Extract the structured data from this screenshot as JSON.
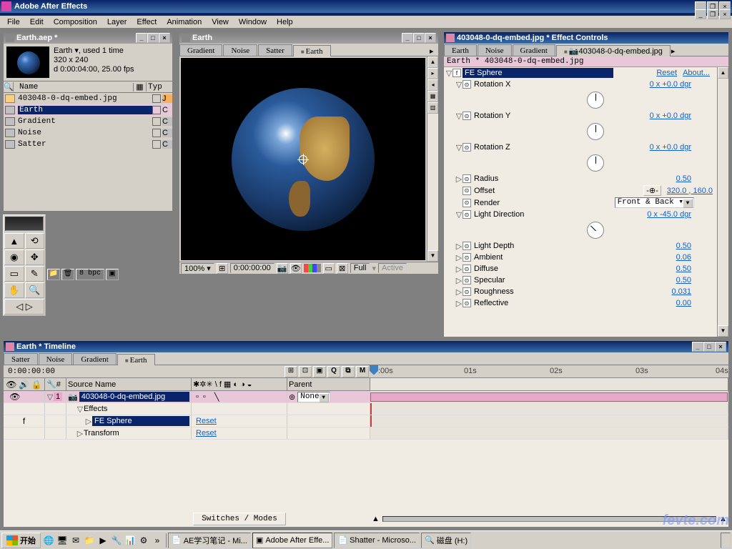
{
  "app": {
    "title": "Adobe After Effects"
  },
  "menu": [
    "File",
    "Edit",
    "Composition",
    "Layer",
    "Effect",
    "Animation",
    "View",
    "Window",
    "Help"
  ],
  "project": {
    "title": "Earth.aep *",
    "info_name": "Earth ▾, used 1 time",
    "info_dims": "320 x 240",
    "info_dur": "d 0:00:04:00, 25.00 fps",
    "col_name": "Name",
    "col_type": "Typ",
    "items": [
      {
        "name": "403048-0-dq-embed.jpg",
        "type": "img",
        "color": "#f8b060"
      },
      {
        "name": "Earth",
        "type": "comp",
        "color": "#e8c8d8",
        "sel": true
      },
      {
        "name": "Gradient",
        "type": "comp",
        "color": "#c0c0c0"
      },
      {
        "name": "Noise",
        "type": "comp",
        "color": "#c0c0c0"
      },
      {
        "name": "Satter",
        "type": "comp",
        "color": "#c0c0c0"
      }
    ],
    "bpc": "8 bpc"
  },
  "comp": {
    "title": "Earth",
    "tabs": [
      "Gradient",
      "Noise",
      "Satter",
      "Earth"
    ],
    "active_tab": "Earth",
    "zoom": "100% ▾",
    "time": "0:00:00:00",
    "res": "Full",
    "active": "Active"
  },
  "effects": {
    "title": "403048-0-dq-embed.jpg * Effect Controls",
    "tabs": [
      "Earth",
      "Noise",
      "Gradient",
      "403048-0-dq-embed.jpg"
    ],
    "active_tab": "403048-0-dq-embed.jpg",
    "breadcrumb": "Earth * 403048-0-dq-embed.jpg",
    "effect_name": "FE Sphere",
    "reset": "Reset",
    "about": "About...",
    "params": [
      {
        "name": "Rotation X",
        "val": "0 x +0.0 dgr",
        "dial": true,
        "tw": "▽"
      },
      {
        "name": "Rotation Y",
        "val": "0 x +0.0 dgr",
        "dial": true,
        "tw": "▽"
      },
      {
        "name": "Rotation Z",
        "val": "0 x +0.0 dgr",
        "dial": true,
        "tw": "▽"
      },
      {
        "name": "Radius",
        "val": "0.50",
        "tw": "▷"
      },
      {
        "name": "Offset",
        "val": "320.0 , 160.0",
        "crosshair": true
      },
      {
        "name": "Render",
        "val": "Front & Back ▾",
        "dropdown": true
      },
      {
        "name": "Light Direction",
        "val": "0 x -45.0 dgr",
        "dial": true,
        "dial45": true,
        "tw": "▽"
      },
      {
        "name": "Light Depth",
        "val": "0.50",
        "tw": "▷"
      },
      {
        "name": "Ambient",
        "val": "0.06",
        "tw": "▷"
      },
      {
        "name": "Diffuse",
        "val": "0.50",
        "tw": "▷"
      },
      {
        "name": "Specular",
        "val": "0.50",
        "tw": "▷"
      },
      {
        "name": "Roughness",
        "val": "0.031",
        "tw": "▷"
      },
      {
        "name": "Reflective",
        "val": "0.00",
        "tw": "▷"
      }
    ]
  },
  "timeline": {
    "title": "Earth * Timeline",
    "tabs": [
      "Satter",
      "Noise",
      "Gradient",
      "Earth"
    ],
    "active_tab": "Earth",
    "time": "0:00:00:00",
    "col_source": "Source Name",
    "col_parent": "Parent",
    "ruler": [
      ":00s",
      "01s",
      "02s",
      "03s",
      "04s"
    ],
    "layer": {
      "num": "1",
      "name": "403048-0-dq-embed.jpg",
      "parent": "None"
    },
    "sub": [
      {
        "name": "Effects",
        "tw": "▽"
      },
      {
        "name": "FE Sphere",
        "tw": "▷",
        "reset": "Reset",
        "hl": true,
        "indent": 1
      },
      {
        "name": "Transform",
        "tw": "▷",
        "reset": "Reset"
      }
    ],
    "switches_btn": "Switches / Modes"
  },
  "taskbar": {
    "start": "开始",
    "items": [
      {
        "label": "AE学习笔记 - Mi...",
        "icon": "📄"
      },
      {
        "label": "Adobe After Effe...",
        "icon": "▣",
        "active": true
      },
      {
        "label": "Shatter - Microso...",
        "icon": "📄"
      },
      {
        "label": "磁盘 (H:)",
        "icon": "🔍"
      }
    ]
  }
}
